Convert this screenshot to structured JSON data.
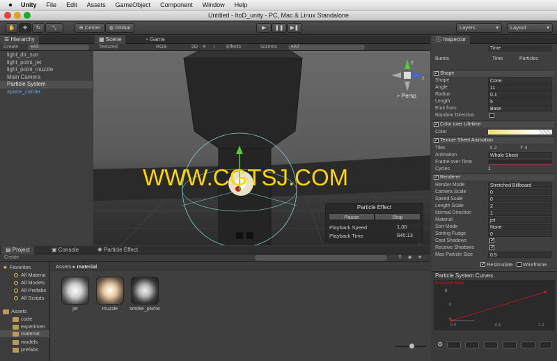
{
  "menubar": {
    "app": "Unity",
    "items": [
      "File",
      "Edit",
      "Assets",
      "GameObject",
      "Component",
      "Window",
      "Help"
    ]
  },
  "window": {
    "title": "Untitled - ItoD_unity - PC, Mac & Linux Standalone"
  },
  "toolbar": {
    "center": "Center",
    "global": "Global",
    "layers": "Layers",
    "layout": "Layout"
  },
  "hierarchy": {
    "tab": "Hierarchy",
    "create": "Create",
    "search": "▾All",
    "items": [
      "light_dir_sun",
      "light_point_jet",
      "light_point_muzzle",
      "Main Camera",
      "Particle System",
      "space_carrier"
    ]
  },
  "scene": {
    "tab": "Scene",
    "game_tab": "Game",
    "shading": "Textured",
    "mode": "RGB",
    "twod": "2D",
    "effects": "Effects",
    "gizmos": "Gizmos",
    "search": "▾All",
    "persp": "Persp",
    "axis_y": "y",
    "axis_z": "z"
  },
  "particle_overlay": {
    "title": "Particle Effect",
    "pause": "Pause",
    "stop": "Stop",
    "speed_label": "Playback Speed",
    "speed_value": "1.00",
    "time_label": "Playback Time",
    "time_value": "840.13"
  },
  "watermark": "WWW.CGTSJ.COM",
  "inspector": {
    "tab": "Inspector",
    "time": "Time",
    "bursts_label": "Bursts",
    "bursts_time": "Time",
    "bursts_particles": "Particles",
    "shape_section": "Shape",
    "shape_rows": [
      {
        "label": "Shape",
        "value": "Cone"
      },
      {
        "label": "Angle",
        "value": "11"
      },
      {
        "label": "Radius",
        "value": "0.1"
      },
      {
        "label": "Length",
        "value": "5"
      },
      {
        "label": "Emit from:",
        "value": "Base"
      },
      {
        "label": "Random Direction",
        "value": ""
      }
    ],
    "col_section": "Color over Lifetime",
    "color_label": "Color",
    "tsa_section": "Texture Sheet Animation",
    "tiles_label": "Tiles",
    "tiles_x": "X  2",
    "tiles_y": "Y  4",
    "animation_label": "Animation",
    "animation_value": "Whole Sheet",
    "frame_label": "Frame over Time",
    "cycles_label": "Cycles",
    "cycles_value": "1",
    "renderer_section": "Renderer",
    "renderer_rows": [
      {
        "label": "Render Mode",
        "value": "Stretched Billboard"
      },
      {
        "label": "Camera Scale",
        "value": "0"
      },
      {
        "label": "Speed Scale",
        "value": "0"
      },
      {
        "label": "Length Scale",
        "value": "2"
      },
      {
        "label": "Normal Direction",
        "value": "1"
      },
      {
        "label": "Material",
        "value": "jet"
      },
      {
        "label": "Sort Mode",
        "value": "None"
      },
      {
        "label": "Sorting Fudge",
        "value": "0"
      },
      {
        "label": "Cast Shadows",
        "value": ""
      },
      {
        "label": "Receive Shadows",
        "value": ""
      },
      {
        "label": "Max Particle Size",
        "value": "0.5"
      }
    ],
    "resimulate": "Resimulate",
    "wireframe": "Wireframe"
  },
  "curves": {
    "title": "Particle System Curves",
    "curve_name": "Emission Rate",
    "y_top": "8",
    "y_mid": "0",
    "y_zero": "0",
    "x_labels": [
      "0.0",
      "0.5",
      "1.0"
    ]
  },
  "project": {
    "tabs": [
      "Project",
      "Console",
      "Particle Effect"
    ],
    "create": "Create",
    "breadcrumb_root": "Assets",
    "breadcrumb_sep": "▸",
    "breadcrumb_folder": "material",
    "favorites_label": "Favorites",
    "favorites": [
      "All Materia",
      "All Models",
      "All Prefabs",
      "All Scripts"
    ],
    "assets_label": "Assets",
    "folders": [
      "code",
      "experimen",
      "material",
      "models",
      "prefabs"
    ],
    "assets": [
      "jet",
      "muzzle",
      "smoke_plume"
    ]
  },
  "colors": {
    "accent_blue": "#6aa0e8",
    "watermark": "#ffd400",
    "curve_red": "#d01818"
  }
}
